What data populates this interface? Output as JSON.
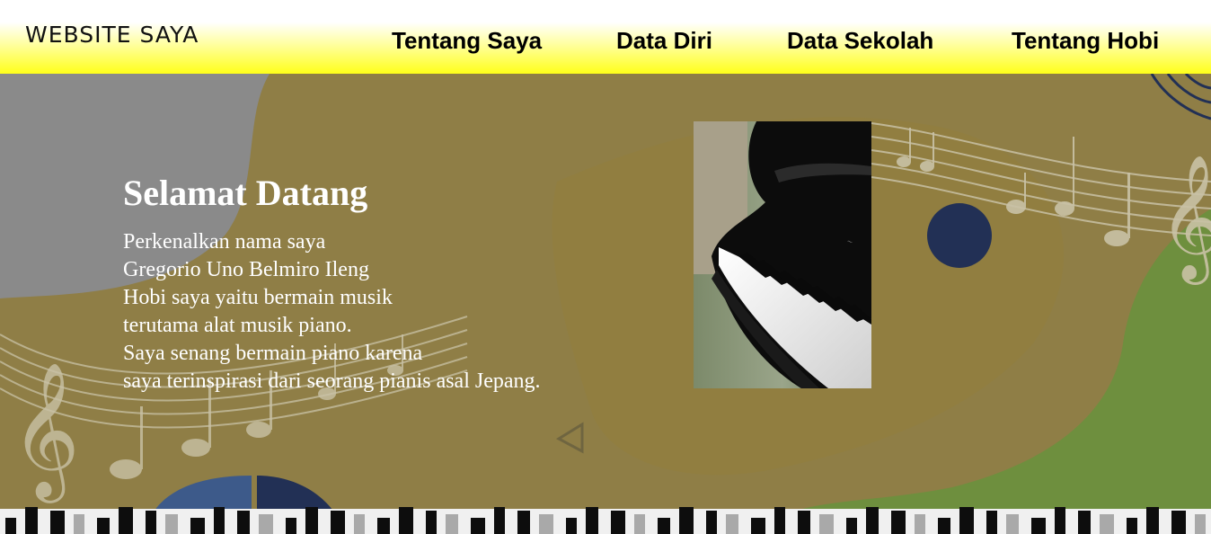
{
  "header": {
    "logo": "WEBSITE SAYA",
    "nav": [
      "Tentang Saya",
      "Data Diri",
      "Data Sekolah",
      "Tentang Hobi"
    ]
  },
  "hero": {
    "title": "Selamat Datang",
    "lines": [
      "Perkenalkan nama saya",
      "Gregorio Uno Belmiro Ileng",
      "Hobi saya yaitu bermain musik",
      "terutama alat musik piano.",
      "Saya senang bermain piano karena",
      "saya terinspirasi dari seorang pianis asal Jepang."
    ]
  },
  "colors": {
    "header_yellow": "#ffff1a",
    "gray": "#8a8a8a",
    "olive": "#8f7e46",
    "green": "#6e8f3e",
    "navy": "#223055"
  }
}
